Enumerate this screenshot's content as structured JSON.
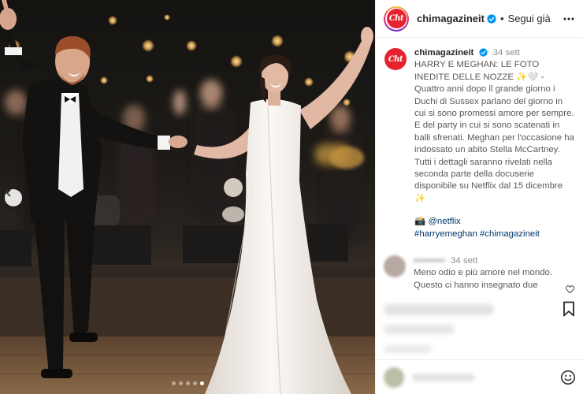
{
  "post": {
    "username": "chimagazineit",
    "logo_text": "Cht",
    "follow_separator": "•",
    "follow_label": "Segui già",
    "caption_time": "34 sett",
    "caption_text": "HARRY E MEGHAN: LE FOTO INEDITE DELLE NOZZE ✨🤍 - Quattro anni dopo il grande giorno i Duchi di Sussex parlano del giorno in cui si sono promessi amore per sempre. E del party in cui si sono scatenati in balli sfrenati. Meghan per l'occasione ha indossato un abito Stella McCartney. Tutti i dettagli saranno rivelati nella seconda parte della docuserie disponibile su Netflix dal 15 dicembre ✨",
    "credit_emoji": "📸",
    "credit_handle": "@netflix",
    "hashtags": "#harryemeghan #chimagazineit"
  },
  "comment": {
    "username": "••••••••••",
    "time": "34 sett",
    "text": "Meno odio e più amore nel mondo. Questo ci hanno insegnato due"
  },
  "carousel": {
    "total": 5,
    "active_index": 4
  },
  "colors": {
    "logo_red": "#e5222d",
    "link_blue": "#00376b",
    "verified_blue": "#0095f6"
  },
  "icons": [
    "more-horizontal-icon",
    "verified-badge-icon",
    "chevron-left-icon",
    "bookmark-icon",
    "emoji-icon",
    "heart-icon"
  ]
}
